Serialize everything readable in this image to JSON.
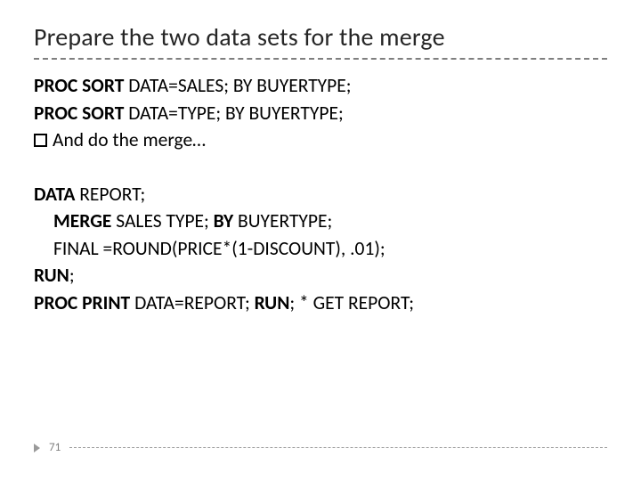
{
  "title": "Prepare the two data sets for the merge",
  "block1": {
    "l1a": "PROC SORT ",
    "l1b": "DATA=SALES; BY BUYERTYPE;",
    "l2a": "PROC SORT ",
    "l2b": "DATA=TYPE; BY BUYERTYPE;",
    "l3": "And  do the merge…"
  },
  "block2": {
    "l1a": "DATA ",
    "l1b": "REPORT;",
    "l2a": "MERGE ",
    "l2b": "SALES TYPE; ",
    "l2c": "BY ",
    "l2d": "BUYERTYPE;",
    "l3": "FINAL =ROUND(PRICE*(1-DISCOUNT), .01);",
    "l4a": "RUN",
    "l4b": ";",
    "l5a": "PROC PRINT ",
    "l5b": "DATA=REPORT; ",
    "l5c": "RUN",
    "l5d": "; * GET REPORT;"
  },
  "pagenum": "71"
}
